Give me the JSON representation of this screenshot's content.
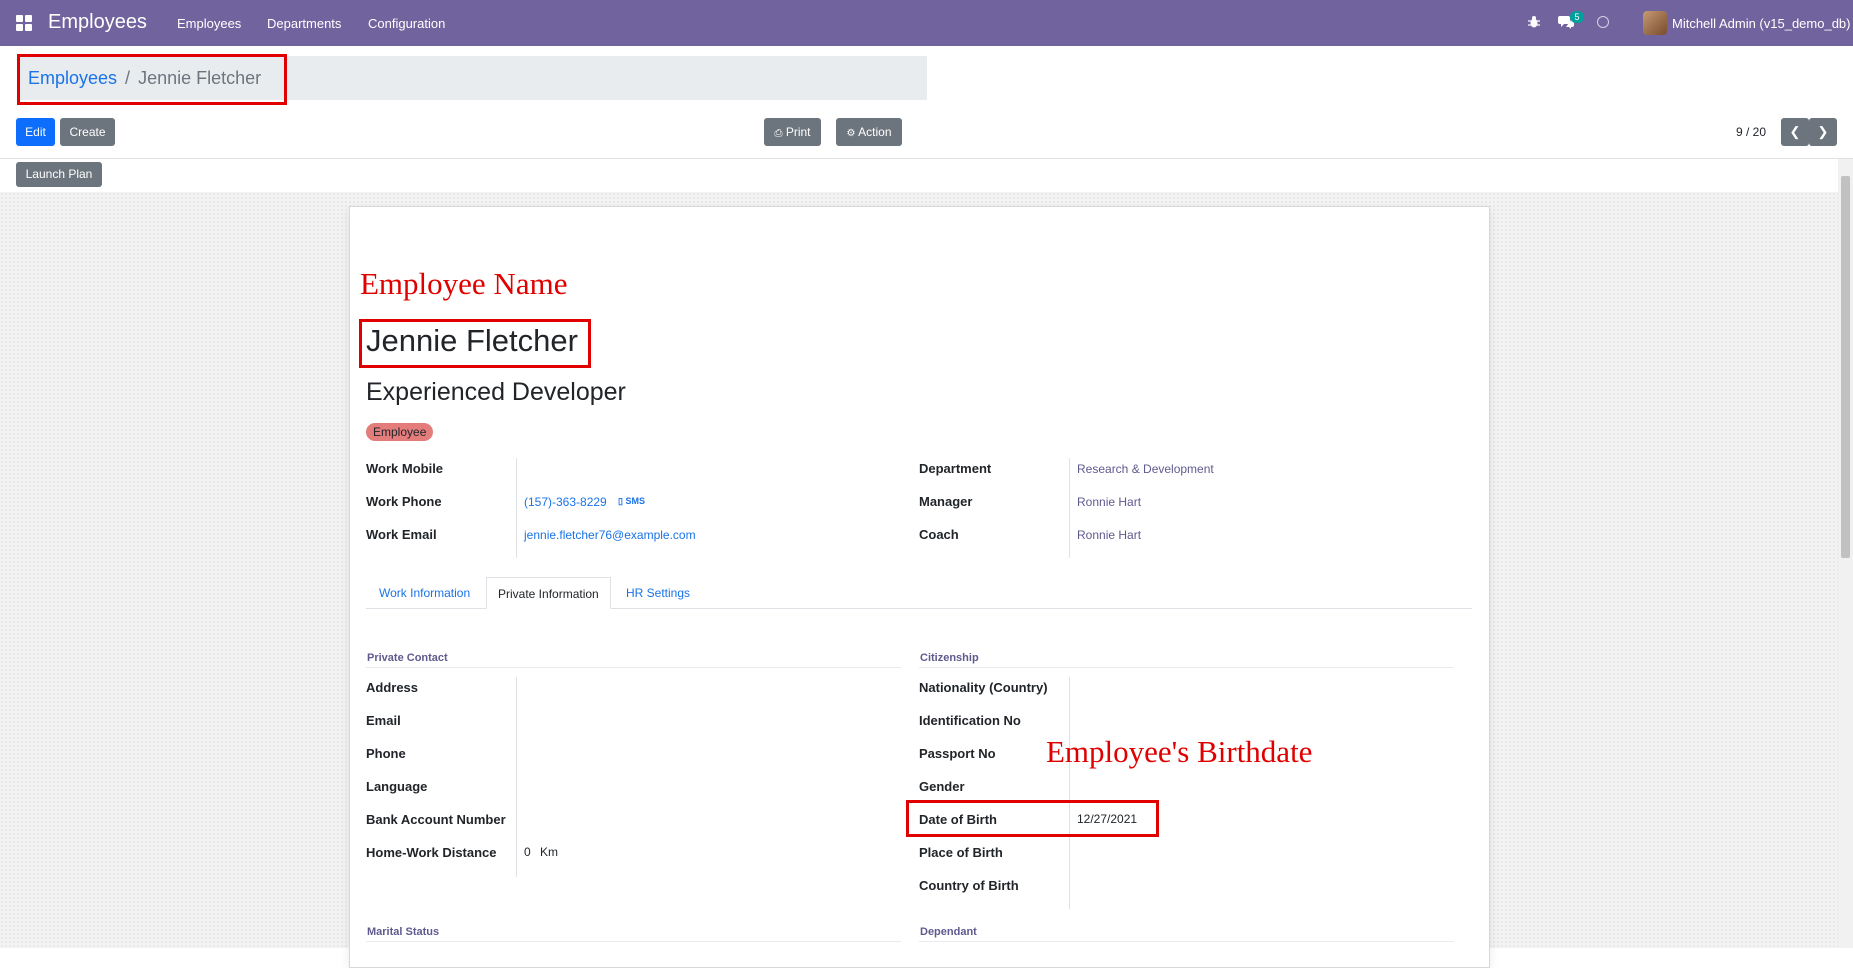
{
  "navbar": {
    "app_title": "Employees",
    "menu": [
      "Employees",
      "Departments",
      "Configuration"
    ],
    "message_count": "5",
    "user": "Mitchell Admin (v15_demo_db)"
  },
  "breadcrumb": {
    "parent": "Employees",
    "separator": "/",
    "current": "Jennie Fletcher"
  },
  "toolbar": {
    "edit_label": "Edit",
    "create_label": "Create",
    "print_label": "Print",
    "action_label": "Action",
    "pager": "9 / 20",
    "launch_plan_label": "Launch Plan"
  },
  "annotations": {
    "employee_name": "Employee Name",
    "birthdate": "Employee's Birthdate"
  },
  "employee": {
    "name": "Jennie Fletcher",
    "job_title": "Experienced Developer",
    "tag": "Employee"
  },
  "contact": {
    "work_mobile_label": "Work Mobile",
    "work_mobile": "",
    "work_phone_label": "Work Phone",
    "work_phone": "(157)-363-8229",
    "sms_label": "SMS",
    "work_email_label": "Work Email",
    "work_email": "jennie.fletcher76@example.com",
    "department_label": "Department",
    "department": "Research & Development",
    "manager_label": "Manager",
    "manager": "Ronnie Hart",
    "coach_label": "Coach",
    "coach": "Ronnie Hart"
  },
  "tabs": [
    "Work Information",
    "Private Information",
    "HR Settings"
  ],
  "private_contact": {
    "title": "Private Contact",
    "address_label": "Address",
    "email_label": "Email",
    "phone_label": "Phone",
    "language_label": "Language",
    "bank_label": "Bank Account Number",
    "distance_label": "Home-Work Distance",
    "distance_value": "0",
    "distance_unit": "Km"
  },
  "citizenship": {
    "title": "Citizenship",
    "nationality_label": "Nationality (Country)",
    "identification_label": "Identification No",
    "passport_label": "Passport No",
    "gender_label": "Gender",
    "dob_label": "Date of Birth",
    "dob": "12/27/2021",
    "pob_label": "Place of Birth",
    "cob_label": "Country of Birth"
  },
  "marital_status": {
    "title": "Marital Status"
  },
  "dependant": {
    "title": "Dependant"
  },
  "colors": {
    "navbar": "#71639e",
    "primary": "#0d6efd",
    "highlight": "#e00000",
    "tag": "#e47c7c"
  }
}
